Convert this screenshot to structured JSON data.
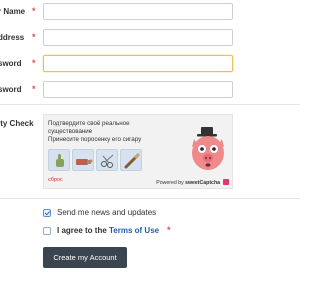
{
  "form": {
    "fields": [
      {
        "label": "r Name",
        "required_mark": "*",
        "value": "",
        "placeholder": ""
      },
      {
        "label": "ddress",
        "required_mark": "*",
        "value": "",
        "placeholder": ""
      },
      {
        "label": "sword",
        "required_mark": "*",
        "value": "",
        "placeholder": ""
      },
      {
        "label": "sword",
        "required_mark": "*",
        "value": "",
        "placeholder": ""
      }
    ],
    "security_label": "ity Check"
  },
  "captcha": {
    "line1": "Подтвердите своё реальное",
    "line2": "существование",
    "line3": "Принесите поросенку его сигару",
    "reset": "сброс",
    "powered_prefix": "Powered by ",
    "powered_brand": "sweetCaptcha",
    "tile_icons": [
      "thumbs-up-icon",
      "lighter-icon",
      "scissors-icon",
      "cigar-icon"
    ],
    "pig_icon": "pig-with-hat-icon"
  },
  "options": {
    "news": {
      "label": "Send me news and updates",
      "checked": true
    },
    "terms": {
      "prefix": "I agree to the ",
      "link": "Terms of Use",
      "required_mark": "*",
      "checked": false
    }
  },
  "submit": {
    "label": "Create my Account"
  },
  "colors": {
    "button_bg": "#3b454f",
    "required": "#d9534f",
    "link": "#1f5fa8",
    "active_border": "#e6c35a"
  }
}
